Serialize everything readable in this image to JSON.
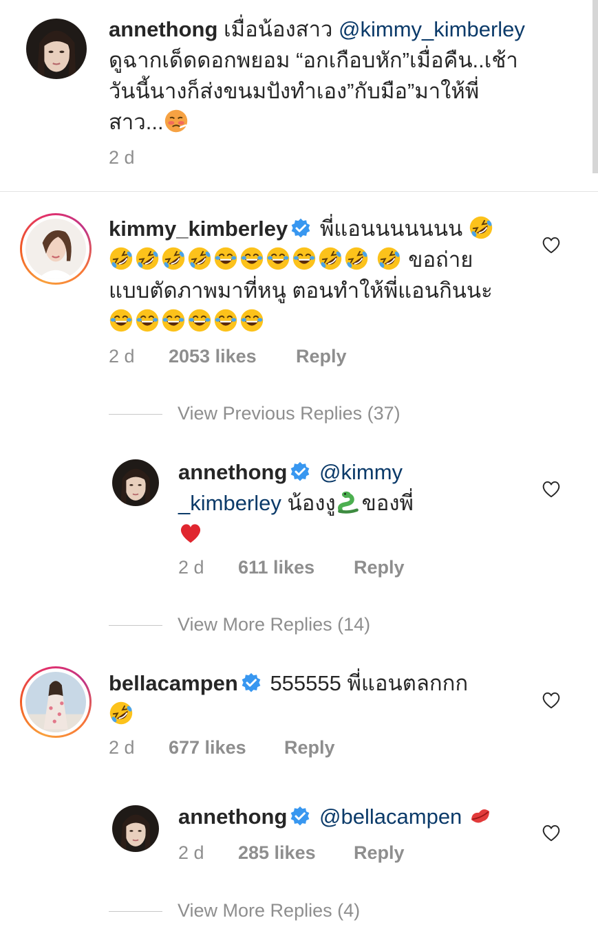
{
  "caption": {
    "username": "annethong",
    "text_1": "เมื่อน้องสาว",
    "mention": "@kimmy_kimberley",
    "line2": "ดูฉากเด็ดดอกพยอม “อกเกือบหัก”เมื่อคืน..เช้า",
    "line3": "วันนี้นางก็ส่งขนมปังทำเอง”กับมือ”มาให้พี่",
    "line4": "สาว...",
    "time": "2 d"
  },
  "comments": [
    {
      "username": "kimmy_kimberley",
      "verified": true,
      "line1": "พี่แอนนนนนนน",
      "line2_text": "ขอถ่าย",
      "line3": "แบบตัดภาพมาที่หนู ตอนทำให้พี่แอนกินนะ",
      "time": "2 d",
      "likes": "2053 likes",
      "reply": "Reply",
      "view_replies": "View Previous Replies (37)",
      "replies": [
        {
          "username": "annethong",
          "verified": true,
          "mention_part1": "@kimmy",
          "mention_part2": "_kimberley",
          "text": "น้องงู",
          "text2": "ของพี่",
          "time": "2 d",
          "likes": "611 likes",
          "reply": "Reply"
        }
      ],
      "view_more": "View More Replies (14)"
    },
    {
      "username": "bellacampen",
      "verified": true,
      "text": "555555 พี่แอนตลกกก",
      "time": "2 d",
      "likes": "677 likes",
      "reply": "Reply",
      "replies": [
        {
          "username": "annethong",
          "verified": true,
          "mention": "@bellacampen",
          "time": "2 d",
          "likes": "285 likes",
          "reply": "Reply"
        }
      ],
      "view_more": "View More Replies (4)"
    }
  ],
  "icons": {
    "heart": "heart-outline-icon",
    "verified": "verified-badge-icon",
    "rofl": "rolling-laughing-emoji",
    "joy": "tears-of-joy-emoji",
    "sick": "woozy-face-emoji",
    "snake": "snake-emoji",
    "red_heart": "red-heart-emoji",
    "kiss": "kiss-mark-emoji"
  },
  "colors": {
    "text": "#262626",
    "secondary": "#8e8e8e",
    "mention": "#0b3a69",
    "verified": "#3897f0"
  }
}
